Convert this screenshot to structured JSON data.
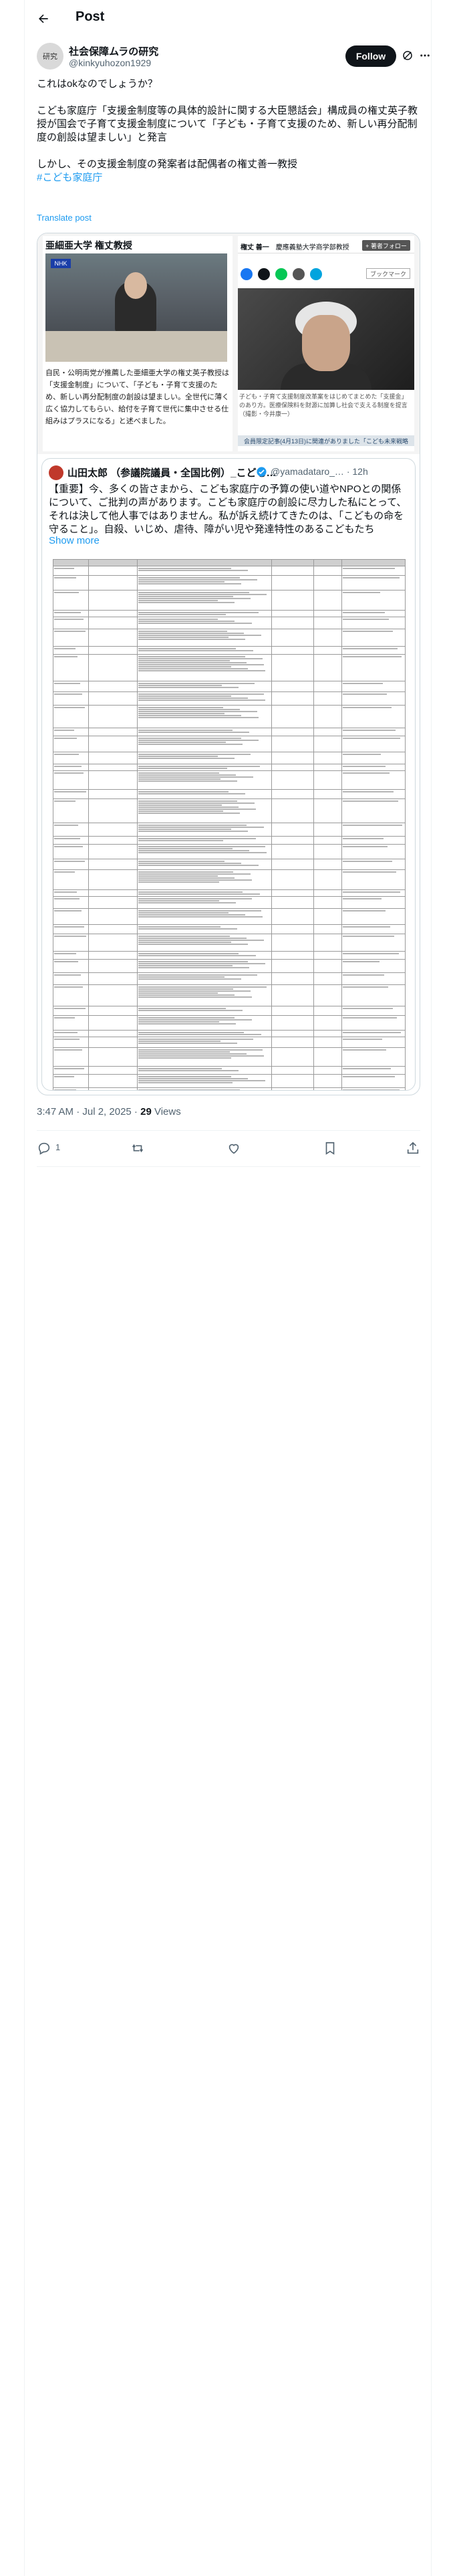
{
  "header": {
    "title": "Post"
  },
  "author": {
    "name": "社会保障ムラの研究",
    "handle": "@kinkyuhozon1929",
    "avatar_text": "研究",
    "follow_label": "Follow"
  },
  "tweet": {
    "text": "これはokなのでしょうか？\n\nこども家庭庁「支援金制度等の具体的設計に関する大臣懇話会」構成員の権丈英子教授が国会で子育て支援金制度について「子ども・子育て支援のため、新しい再分配制度の創設は望ましい」と発言\n\nしかし、その支援金制度の発案者は配偶者の権丈善一教授",
    "hashtag": "#こども家庭庁",
    "translate_label": "Translate post"
  },
  "media": {
    "left_title": "亜細亜大学 権丈教授",
    "left_badge": "NHK",
    "left_caption": "自民・公明両党が推薦した亜細亜大学の権丈英子教授は「支援金制度」について、「子ども・子育て支援のため、新しい再分配制度の創設は望ましい。全世代に薄く広く協力してもらい、給付を子育て世代に集中させる仕組みはプラスになる」と述べました。",
    "right_name": "権丈 善一",
    "right_affiliation": "慶應義塾大学商学部教授",
    "right_follow_label": "+ 著者フォロー",
    "right_bookmark_label": "ブックマーク",
    "right_caption": "子ども・子育て支援制度改革案をはじめてまとめた「支援金」のあり方。医療保険料を財源に加算し社会で支える制度を提言（撮影・今井康一）",
    "right_banner": "会員限定記事(4月13日)に関連がありました「こども未来戦略"
  },
  "quote": {
    "name": "山田太郎 （参議院議員・全国比例）_こども…",
    "handle": "@yamadataro_… · 12h",
    "text": "【重要】今、多くの皆さまから、こども家庭庁の予算の使い道やNPOとの関係について、ご批判の声があります。こども家庭庁の創設に尽力した私にとって、それは決して他人事ではありません。私が訴え続けてきたのは、「こどもの命を守ること」。自殺、いじめ、虐待、障がい児や発達特性のあるこどもたち",
    "show_more": "Show more",
    "doc_rows": 48
  },
  "meta": {
    "time": "3:47 AM · Jul 2, 2025",
    "views_count": "29",
    "views_label": "Views"
  },
  "actions": {
    "reply_count": "1",
    "repost_count": "",
    "like_count": ""
  }
}
